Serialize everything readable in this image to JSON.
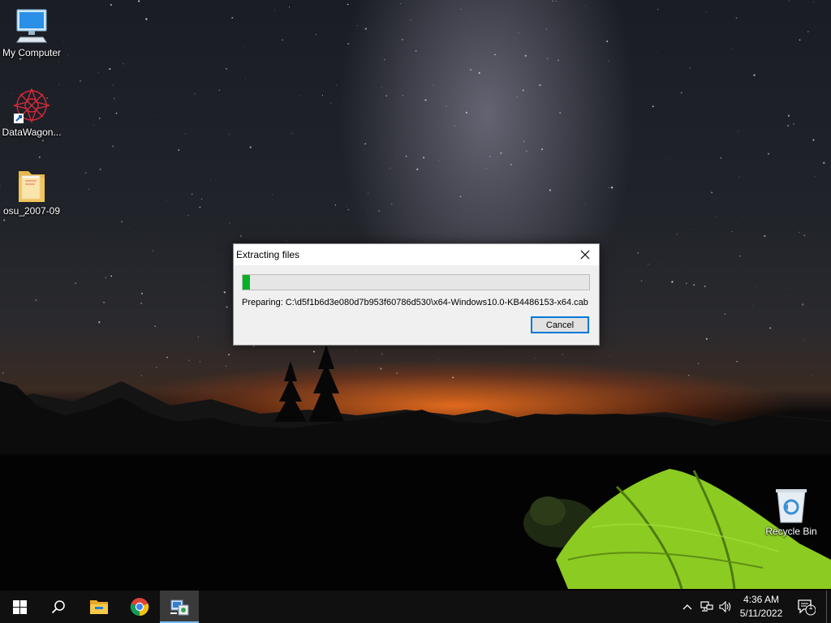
{
  "desktop": {
    "icons": [
      {
        "label": "My Computer",
        "icon": "computer-icon"
      },
      {
        "label": "DataWagon...",
        "icon": "datawagon-shortcut-icon"
      },
      {
        "label": "osu_2007-09",
        "icon": "folder-icon"
      },
      {
        "label": "Recycle Bin",
        "icon": "recycle-bin-icon"
      }
    ]
  },
  "dialog": {
    "title": "Extracting files",
    "close_icon": "close-icon",
    "progress_fraction": 0.02,
    "progress_color": "#06b025",
    "status_text": "Preparing: C:\\d5f1b6d3e080d7b953f60786d530\\x64-Windows10.0-KB4486153-x64.cab",
    "cancel_label": "Cancel",
    "accent_color": "#0078d7"
  },
  "taskbar": {
    "buttons": [
      {
        "name": "start",
        "icon": "windows-start-icon"
      },
      {
        "name": "search",
        "icon": "search-icon"
      },
      {
        "name": "file-explorer",
        "icon": "file-explorer-icon"
      },
      {
        "name": "chrome",
        "icon": "chrome-icon"
      },
      {
        "name": "extractor",
        "icon": "installer-app-icon",
        "active": true
      }
    ],
    "tray": {
      "icons": [
        "chevron-up-icon",
        "network-icon",
        "volume-icon"
      ],
      "time": "4:36 AM",
      "date": "5/11/2022",
      "notification_count": "1"
    }
  }
}
